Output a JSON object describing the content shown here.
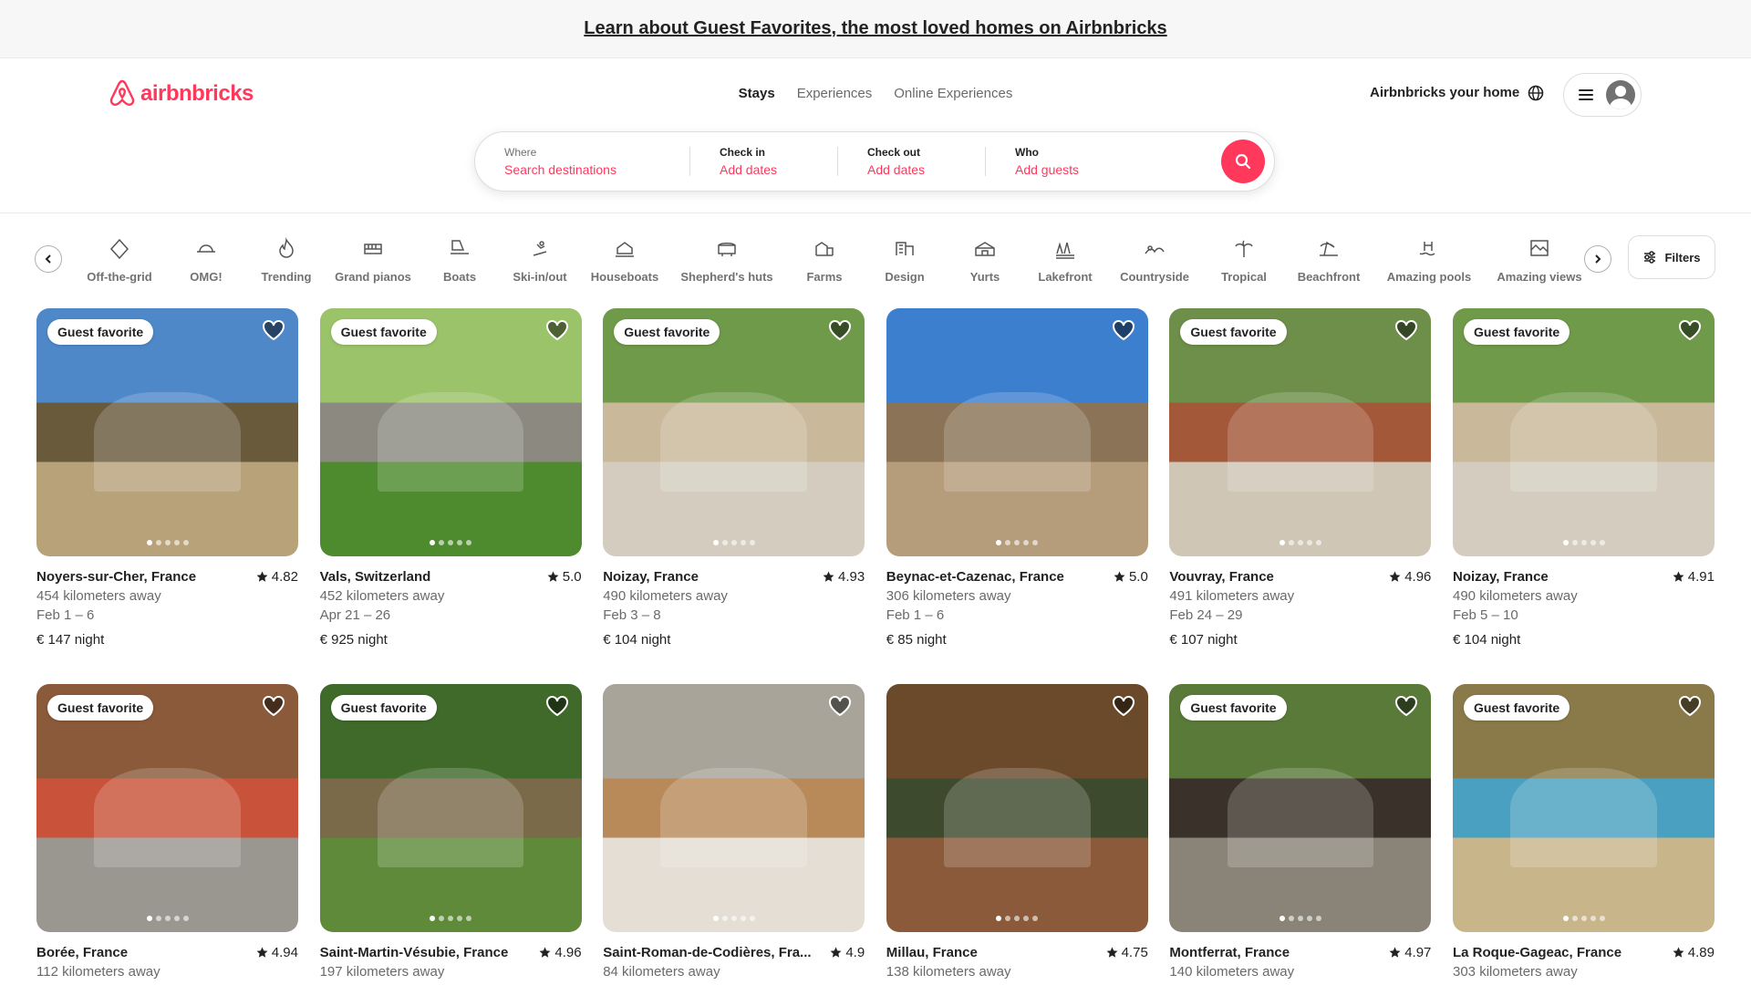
{
  "banner": {
    "text": "Learn about Guest Favorites, the most loved homes on Airbnbricks"
  },
  "header": {
    "logo_text": "airbnbricks",
    "tabs": [
      "Stays",
      "Experiences",
      "Online Experiences"
    ],
    "host_label": "Airbnbricks your home",
    "accent": "#ff385c"
  },
  "search": {
    "where_label": "Where",
    "where_value": "Search destinations",
    "checkin_label": "Check in",
    "checkin_value": "Add dates",
    "checkout_label": "Check out",
    "checkout_value": "Add dates",
    "who_label": "Who",
    "who_value": "Add guests"
  },
  "categories": {
    "items": [
      {
        "label": "Off-the-grid",
        "icon": "off-grid-icon"
      },
      {
        "label": "OMG!",
        "icon": "ufo-icon"
      },
      {
        "label": "Trending",
        "icon": "flame-icon"
      },
      {
        "label": "Grand pianos",
        "icon": "piano-icon"
      },
      {
        "label": "Boats",
        "icon": "boat-icon"
      },
      {
        "label": "Ski-in/out",
        "icon": "skier-icon"
      },
      {
        "label": "Houseboats",
        "icon": "houseboat-icon"
      },
      {
        "label": "Shepherd's huts",
        "icon": "hut-icon"
      },
      {
        "label": "Farms",
        "icon": "farm-icon"
      },
      {
        "label": "Design",
        "icon": "design-icon"
      },
      {
        "label": "Yurts",
        "icon": "yurt-icon"
      },
      {
        "label": "Lakefront",
        "icon": "lake-icon"
      },
      {
        "label": "Countryside",
        "icon": "countryside-icon"
      },
      {
        "label": "Tropical",
        "icon": "palm-icon"
      },
      {
        "label": "Beachfront",
        "icon": "beach-icon"
      },
      {
        "label": "Amazing pools",
        "icon": "pool-icon"
      },
      {
        "label": "Amazing views",
        "icon": "view-icon"
      }
    ],
    "filters_label": "Filters"
  },
  "listings": [
    {
      "favorite": true,
      "location": "Noyers-sur-Cher, France",
      "rating": "4.82",
      "distance": "454 kilometers away",
      "dates": "Feb 1 – 6",
      "price": "€ 147 night",
      "sky": "#4e88c9",
      "ground": "#b8a27a",
      "accent": "#6a5a3c"
    },
    {
      "favorite": true,
      "location": "Vals, Switzerland",
      "rating": "5.0",
      "distance": "452 kilometers away",
      "dates": "Apr 21 – 26",
      "price": "€ 925 night",
      "sky": "#9bc36a",
      "ground": "#4e8a2e",
      "accent": "#8c8a80"
    },
    {
      "favorite": true,
      "location": "Noizay, France",
      "rating": "4.93",
      "distance": "490 kilometers away",
      "dates": "Feb 3 – 8",
      "price": "€ 104 night",
      "sky": "#6f9a4a",
      "ground": "#d4cdbf",
      "accent": "#c9b99a"
    },
    {
      "favorite": false,
      "location": "Beynac-et-Cazenac, France",
      "rating": "5.0",
      "distance": "306 kilometers away",
      "dates": "Feb 1 – 6",
      "price": "€ 85 night",
      "sky": "#3d7fcf",
      "ground": "#b59c7a",
      "accent": "#8a7356"
    },
    {
      "favorite": true,
      "location": "Vouvray, France",
      "rating": "4.96",
      "distance": "491 kilometers away",
      "dates": "Feb 24 – 29",
      "price": "€ 107 night",
      "sky": "#6d8f4a",
      "ground": "#cfc6b5",
      "accent": "#a3583a"
    },
    {
      "favorite": true,
      "location": "Noizay, France",
      "rating": "4.91",
      "distance": "490 kilometers away",
      "dates": "Feb 5 – 10",
      "price": "€ 104 night",
      "sky": "#6f9a4a",
      "ground": "#d4cdbf",
      "accent": "#c9b99a"
    },
    {
      "favorite": true,
      "location": "Borée, France",
      "rating": "4.94",
      "distance": "112 kilometers away",
      "dates": "",
      "price": "",
      "sky": "#8a5a3a",
      "ground": "#9a9690",
      "accent": "#c8533a"
    },
    {
      "favorite": true,
      "location": "Saint-Martin-Vésubie, France",
      "rating": "4.96",
      "distance": "197 kilometers away",
      "dates": "",
      "price": "",
      "sky": "#3f6a2a",
      "ground": "#5f8a3a",
      "accent": "#7a6a4a"
    },
    {
      "favorite": false,
      "location": "Saint-Roman-de-Codières, Fra...",
      "rating": "4.9",
      "distance": "84 kilometers away",
      "dates": "",
      "price": "",
      "sky": "#a8a49a",
      "ground": "#e4ded4",
      "accent": "#b88a5a"
    },
    {
      "favorite": false,
      "location": "Millau, France",
      "rating": "4.75",
      "distance": "138 kilometers away",
      "dates": "",
      "price": "",
      "sky": "#6a4a2a",
      "ground": "#8a5a3a",
      "accent": "#3e4a2e"
    },
    {
      "favorite": true,
      "location": "Montferrat, France",
      "rating": "4.97",
      "distance": "140 kilometers away",
      "dates": "",
      "price": "",
      "sky": "#5a7a3a",
      "ground": "#8a8478",
      "accent": "#3a322a"
    },
    {
      "favorite": true,
      "location": "La Roque-Gageac, France",
      "rating": "4.89",
      "distance": "303 kilometers away",
      "dates": "",
      "price": "",
      "sky": "#8a7a4a",
      "ground": "#c9b58a",
      "accent": "#4aa0c0"
    }
  ],
  "badge_label": "Guest favorite"
}
